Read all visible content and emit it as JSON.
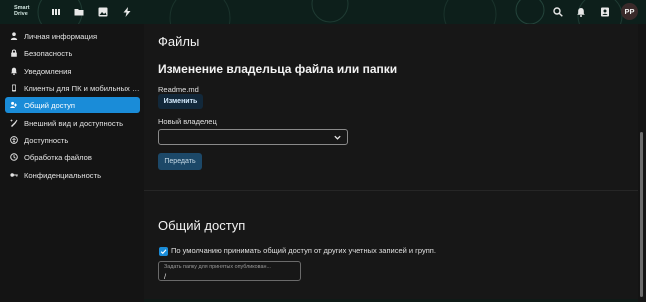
{
  "app": {
    "logo_line1": "Smart",
    "logo_line2": "Drive"
  },
  "header": {
    "left_icons": [
      "grid-icon",
      "folder-icon",
      "image-icon",
      "lightning-icon"
    ],
    "right_icons": [
      "search-icon",
      "bell-icon",
      "contacts-icon"
    ],
    "avatar_initials": "PP"
  },
  "sidebar": {
    "items": [
      {
        "label": "Личная информация",
        "icon": "user-icon"
      },
      {
        "label": "Безопасность",
        "icon": "lock-icon"
      },
      {
        "label": "Уведомления",
        "icon": "bell-icon"
      },
      {
        "label": "Клиенты для ПК и мобильных ус...",
        "icon": "phone-icon"
      },
      {
        "label": "Общий доступ",
        "icon": "share-icon",
        "active": true
      },
      {
        "label": "Внешний вид и доступность",
        "icon": "paint-icon"
      },
      {
        "label": "Доступность",
        "icon": "accessibility-icon"
      },
      {
        "label": "Обработка файлов",
        "icon": "file-processing-icon"
      },
      {
        "label": "Конфиденциальность",
        "icon": "key-icon"
      }
    ]
  },
  "main": {
    "page_title": "Файлы",
    "section_title": "Изменение владельца файла или папки",
    "file_name": "Readme.md",
    "change_button": "Изменить",
    "new_owner_label": "Новый владелец",
    "new_owner_value": "",
    "transfer_button": "Передать",
    "share_title": "Общий доступ",
    "accept_checkbox_label": "По умолчанию принимать общий доступ от других учетных записей и групп.",
    "accept_checked": true,
    "folder_field_label": "Задать папку для принятых опубликован...",
    "folder_field_value": "/"
  },
  "colors": {
    "accent": "#1a8cd8",
    "background": "#171717",
    "sidebar": "#141414"
  }
}
